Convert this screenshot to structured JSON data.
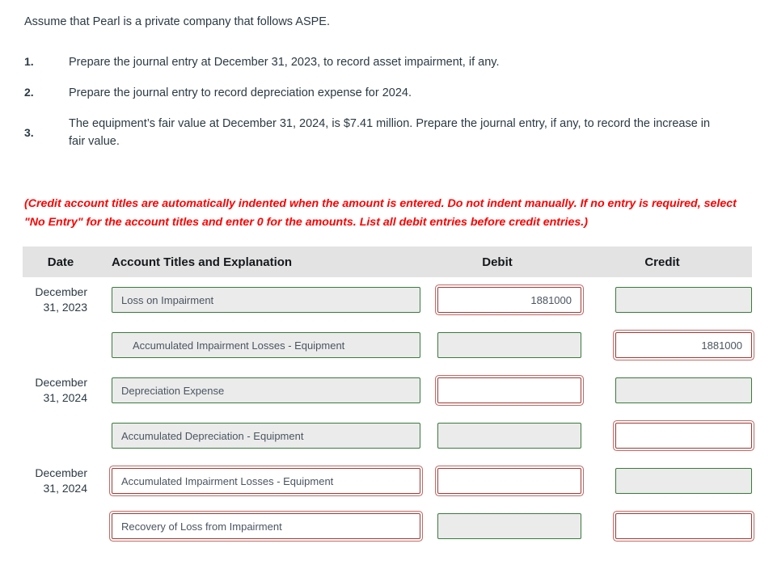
{
  "intro": "Assume that Pearl is a private company that follows ASPE.",
  "requirements": [
    {
      "number": "1.",
      "text": "Prepare the journal entry at December 31, 2023, to record asset impairment, if any."
    },
    {
      "number": "2.",
      "text": "Prepare the journal entry to record depreciation expense for 2024."
    },
    {
      "number": "3.",
      "text": "The equipment’s fair value at December 31, 2024, is $7.41 million. Prepare the journal entry, if any, to record the increase in fair value."
    }
  ],
  "instruction_note": "(Credit account titles are automatically indented when the amount is entered. Do not indent manually. If no entry is required, select \"No Entry\" for the account titles and enter 0 for the amounts. List all debit entries before credit entries.)",
  "table": {
    "headers": {
      "date": "Date",
      "account": "Account Titles and Explanation",
      "debit": "Debit",
      "credit": "Credit"
    },
    "rows": [
      {
        "date": "December 31, 2023",
        "account_value": "Loss on Impairment",
        "account_state": "green",
        "account_indent": false,
        "debit_value": "1881000",
        "debit_state": "red",
        "credit_value": "",
        "credit_state": "green"
      },
      {
        "date": "",
        "account_value": "Accumulated Impairment Losses - Equipment",
        "account_state": "green",
        "account_indent": true,
        "debit_value": "",
        "debit_state": "green",
        "credit_value": "1881000",
        "credit_state": "red"
      },
      {
        "date": "December 31, 2024",
        "account_value": "Depreciation Expense",
        "account_state": "green",
        "account_indent": false,
        "debit_value": "",
        "debit_state": "red",
        "credit_value": "",
        "credit_state": "green"
      },
      {
        "date": "",
        "account_value": "Accumulated Depreciation - Equipment",
        "account_state": "green",
        "account_indent": false,
        "debit_value": "",
        "debit_state": "green",
        "credit_value": "",
        "credit_state": "red"
      },
      {
        "date": "December 31, 2024",
        "account_value": "Accumulated Impairment Losses - Equipment",
        "account_state": "red",
        "account_indent": false,
        "debit_value": "",
        "debit_state": "red",
        "credit_value": "",
        "credit_state": "green"
      },
      {
        "date": "",
        "account_value": "Recovery of Loss from Impairment",
        "account_state": "red",
        "account_indent": false,
        "debit_value": "",
        "debit_state": "green",
        "credit_value": "",
        "credit_state": "red"
      }
    ]
  },
  "colors": {
    "header_bg": "#e3e3e3",
    "note_red": "#ff0000",
    "field_green_border": "#3a7a3d",
    "field_red_border": "#a03a36",
    "field_grey_fill": "#ebebeb",
    "text": "#2b3a44"
  }
}
